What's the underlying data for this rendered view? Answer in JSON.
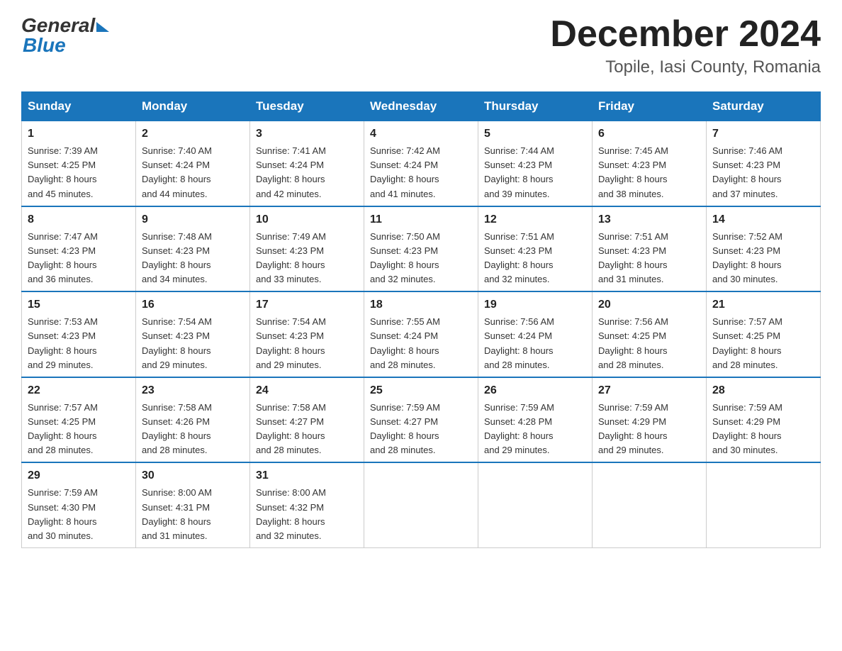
{
  "logo": {
    "general": "General",
    "blue": "Blue"
  },
  "title": "December 2024",
  "location": "Topile, Iasi County, Romania",
  "days_of_week": [
    "Sunday",
    "Monday",
    "Tuesday",
    "Wednesday",
    "Thursday",
    "Friday",
    "Saturday"
  ],
  "weeks": [
    [
      {
        "day": "1",
        "sunrise": "7:39 AM",
        "sunset": "4:25 PM",
        "daylight": "8 hours and 45 minutes."
      },
      {
        "day": "2",
        "sunrise": "7:40 AM",
        "sunset": "4:24 PM",
        "daylight": "8 hours and 44 minutes."
      },
      {
        "day": "3",
        "sunrise": "7:41 AM",
        "sunset": "4:24 PM",
        "daylight": "8 hours and 42 minutes."
      },
      {
        "day": "4",
        "sunrise": "7:42 AM",
        "sunset": "4:24 PM",
        "daylight": "8 hours and 41 minutes."
      },
      {
        "day": "5",
        "sunrise": "7:44 AM",
        "sunset": "4:23 PM",
        "daylight": "8 hours and 39 minutes."
      },
      {
        "day": "6",
        "sunrise": "7:45 AM",
        "sunset": "4:23 PM",
        "daylight": "8 hours and 38 minutes."
      },
      {
        "day": "7",
        "sunrise": "7:46 AM",
        "sunset": "4:23 PM",
        "daylight": "8 hours and 37 minutes."
      }
    ],
    [
      {
        "day": "8",
        "sunrise": "7:47 AM",
        "sunset": "4:23 PM",
        "daylight": "8 hours and 36 minutes."
      },
      {
        "day": "9",
        "sunrise": "7:48 AM",
        "sunset": "4:23 PM",
        "daylight": "8 hours and 34 minutes."
      },
      {
        "day": "10",
        "sunrise": "7:49 AM",
        "sunset": "4:23 PM",
        "daylight": "8 hours and 33 minutes."
      },
      {
        "day": "11",
        "sunrise": "7:50 AM",
        "sunset": "4:23 PM",
        "daylight": "8 hours and 32 minutes."
      },
      {
        "day": "12",
        "sunrise": "7:51 AM",
        "sunset": "4:23 PM",
        "daylight": "8 hours and 32 minutes."
      },
      {
        "day": "13",
        "sunrise": "7:51 AM",
        "sunset": "4:23 PM",
        "daylight": "8 hours and 31 minutes."
      },
      {
        "day": "14",
        "sunrise": "7:52 AM",
        "sunset": "4:23 PM",
        "daylight": "8 hours and 30 minutes."
      }
    ],
    [
      {
        "day": "15",
        "sunrise": "7:53 AM",
        "sunset": "4:23 PM",
        "daylight": "8 hours and 29 minutes."
      },
      {
        "day": "16",
        "sunrise": "7:54 AM",
        "sunset": "4:23 PM",
        "daylight": "8 hours and 29 minutes."
      },
      {
        "day": "17",
        "sunrise": "7:54 AM",
        "sunset": "4:23 PM",
        "daylight": "8 hours and 29 minutes."
      },
      {
        "day": "18",
        "sunrise": "7:55 AM",
        "sunset": "4:24 PM",
        "daylight": "8 hours and 28 minutes."
      },
      {
        "day": "19",
        "sunrise": "7:56 AM",
        "sunset": "4:24 PM",
        "daylight": "8 hours and 28 minutes."
      },
      {
        "day": "20",
        "sunrise": "7:56 AM",
        "sunset": "4:25 PM",
        "daylight": "8 hours and 28 minutes."
      },
      {
        "day": "21",
        "sunrise": "7:57 AM",
        "sunset": "4:25 PM",
        "daylight": "8 hours and 28 minutes."
      }
    ],
    [
      {
        "day": "22",
        "sunrise": "7:57 AM",
        "sunset": "4:25 PM",
        "daylight": "8 hours and 28 minutes."
      },
      {
        "day": "23",
        "sunrise": "7:58 AM",
        "sunset": "4:26 PM",
        "daylight": "8 hours and 28 minutes."
      },
      {
        "day": "24",
        "sunrise": "7:58 AM",
        "sunset": "4:27 PM",
        "daylight": "8 hours and 28 minutes."
      },
      {
        "day": "25",
        "sunrise": "7:59 AM",
        "sunset": "4:27 PM",
        "daylight": "8 hours and 28 minutes."
      },
      {
        "day": "26",
        "sunrise": "7:59 AM",
        "sunset": "4:28 PM",
        "daylight": "8 hours and 29 minutes."
      },
      {
        "day": "27",
        "sunrise": "7:59 AM",
        "sunset": "4:29 PM",
        "daylight": "8 hours and 29 minutes."
      },
      {
        "day": "28",
        "sunrise": "7:59 AM",
        "sunset": "4:29 PM",
        "daylight": "8 hours and 30 minutes."
      }
    ],
    [
      {
        "day": "29",
        "sunrise": "7:59 AM",
        "sunset": "4:30 PM",
        "daylight": "8 hours and 30 minutes."
      },
      {
        "day": "30",
        "sunrise": "8:00 AM",
        "sunset": "4:31 PM",
        "daylight": "8 hours and 31 minutes."
      },
      {
        "day": "31",
        "sunrise": "8:00 AM",
        "sunset": "4:32 PM",
        "daylight": "8 hours and 32 minutes."
      },
      null,
      null,
      null,
      null
    ]
  ],
  "labels": {
    "sunrise": "Sunrise:",
    "sunset": "Sunset:",
    "daylight": "Daylight:"
  }
}
